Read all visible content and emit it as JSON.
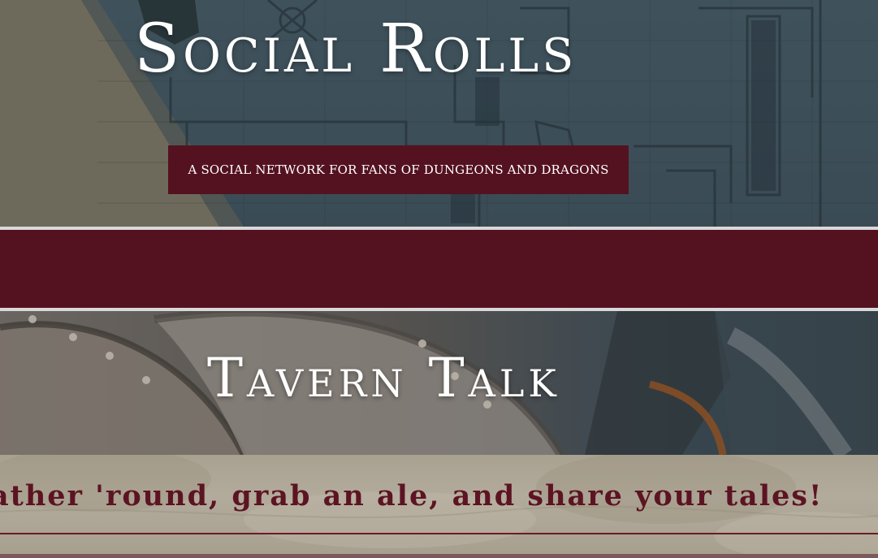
{
  "hero": {
    "title": "Social Rolls",
    "subtitle": "A Social Network for Fans of Dungeons and Dragons"
  },
  "tavern": {
    "title": "Tavern Talk"
  },
  "parchment": {
    "tagline": "ather 'round, grab an ale, and share your tales!"
  },
  "colors": {
    "accent": "#541221",
    "hero_overlay": "#3f525c",
    "tagline": "#5c1422",
    "parchment": "#b2ab9c"
  }
}
